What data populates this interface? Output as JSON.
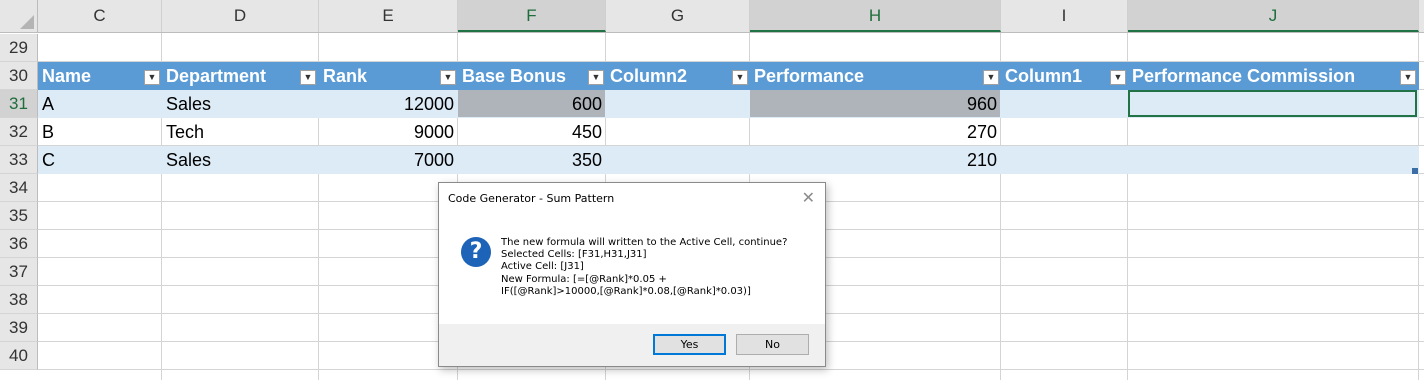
{
  "columns": [
    "C",
    "D",
    "E",
    "F",
    "G",
    "H",
    "I",
    "J"
  ],
  "rows": [
    "29",
    "30",
    "31",
    "32",
    "33",
    "34",
    "35",
    "36",
    "37",
    "38",
    "39",
    "40"
  ],
  "table": {
    "headers": [
      "Name",
      "Department",
      "Rank",
      "Base Bonus",
      "Column2",
      "Performance",
      "Column1",
      "Performance Commission"
    ],
    "filter_icon": "dropdown-arrow-icon",
    "body": [
      [
        "A",
        "Sales",
        "12000",
        "600",
        "",
        "960",
        "",
        ""
      ],
      [
        "B",
        "Tech",
        "9000",
        "450",
        "",
        "270",
        "",
        ""
      ],
      [
        "C",
        "Sales",
        "7000",
        "350",
        "",
        "210",
        "",
        ""
      ]
    ]
  },
  "colors": {
    "table_header": "#5b9bd5",
    "band": "#ddebf7",
    "selected_cell": "#aeb4ba",
    "accent": "#217346"
  },
  "dialog": {
    "title": "Code Generator - Sum Pattern",
    "close": "✕",
    "icon": "?",
    "message_lines": [
      "The new formula will written to the Active Cell, continue?",
      "Selected Cells: [F31,H31,J31]",
      "Active Cell: [J31]",
      "New Formula: [=[@Rank]*0.05 +",
      "IF([@Rank]>10000,[@Rank]*0.08,[@Rank]*0.03)]"
    ],
    "yes_label": "Yes",
    "no_label": "No"
  }
}
